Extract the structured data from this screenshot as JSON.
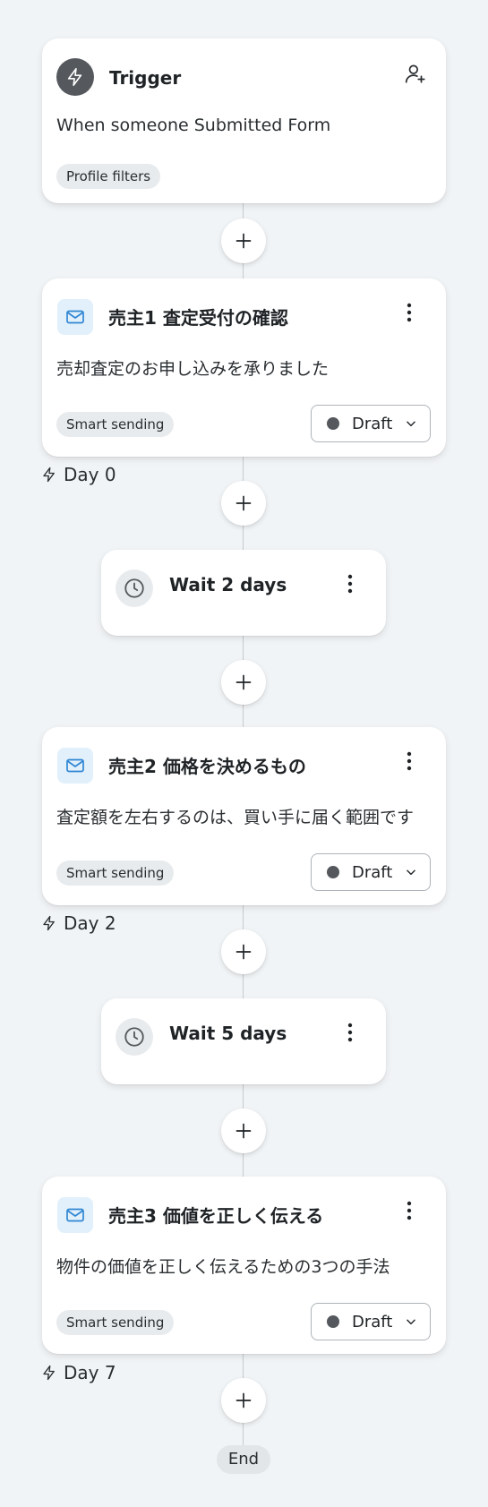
{
  "trigger": {
    "title": "Trigger",
    "description": "When someone Submitted Form",
    "filter_tag": "Profile filters"
  },
  "emails": [
    {
      "title": "売主1 査定受付の確認",
      "subject": "売却査定のお申し込みを承りました",
      "tag": "Smart sending",
      "status": "Draft",
      "day_label": "Day 0"
    },
    {
      "title": "売主2 価格を決めるもの",
      "subject": "査定額を左右するのは、買い手に届く範囲です",
      "tag": "Smart sending",
      "status": "Draft",
      "day_label": "Day 2"
    },
    {
      "title": "売主3 価値を正しく伝える",
      "subject": "物件の価値を正しく伝えるための3つの手法",
      "tag": "Smart sending",
      "status": "Draft",
      "day_label": "Day 7"
    }
  ],
  "waits": [
    {
      "label": "Wait 2 days"
    },
    {
      "label": "Wait 5 days"
    }
  ],
  "end_label": "End",
  "colors": {
    "background": "#f1f4f6",
    "card": "#ffffff",
    "mail_icon": "#2f86d3",
    "mail_icon_bg": "#e2f0fb",
    "status_dot": "#55595d"
  },
  "icons": {
    "trigger": "lightning-icon",
    "profile": "add-user-icon",
    "email": "mail-icon",
    "wait": "clock-icon",
    "menu": "more-vertical-icon",
    "add": "plus-icon",
    "status": "chevron-down-icon",
    "day": "lightning-icon"
  }
}
